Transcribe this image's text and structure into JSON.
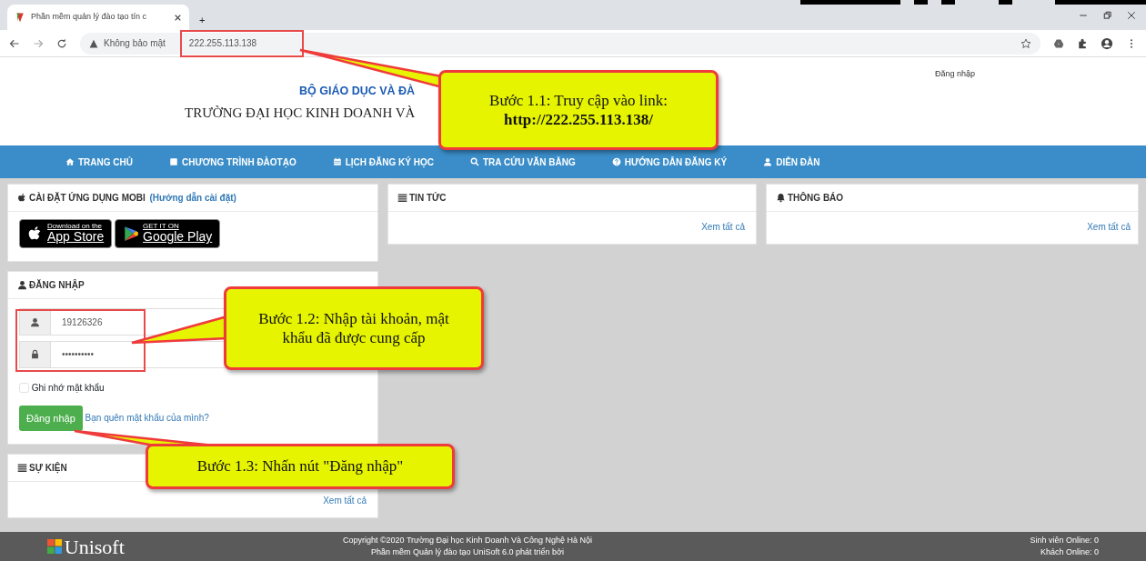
{
  "browser": {
    "tab_title": "Phần mềm quản lý đào tạo tín c",
    "new_tab": "+",
    "security_label": "Không bảo mật",
    "url": "222.255.113.138"
  },
  "header": {
    "ministry": "BỘ GIÁO DỤC VÀ ĐÀ",
    "university": "TRƯỜNG ĐẠI HỌC KINH DOANH VÀ",
    "login_link": "Đăng nhập"
  },
  "nav": [
    {
      "kind": "home",
      "label": "TRANG CHỦ"
    },
    {
      "kind": "book",
      "label": "CHƯƠNG TRÌNH ĐÀOTẠO"
    },
    {
      "kind": "calendar",
      "label": "LỊCH ĐĂNG KÝ HỌC"
    },
    {
      "kind": "search",
      "label": "TRA CỨU VĂN BẰNG"
    },
    {
      "kind": "question",
      "label": "HƯỚNG DẪN ĐĂNG KÝ"
    },
    {
      "kind": "user",
      "label": "DIỄN ĐÀN"
    }
  ],
  "mobile_panel": {
    "title": "CÀI ĐẶT ỨNG DỤNG MOBI",
    "guide_link": "(Hướng dẫn cài đặt)",
    "stores": [
      {
        "kind": "apple",
        "small": "Download on the",
        "big": "App Store"
      },
      {
        "kind": "google",
        "small": "GET IT ON",
        "big": "Google Play"
      }
    ]
  },
  "login_panel": {
    "title": "ĐĂNG NHẬP",
    "username": "19126326",
    "password": "••••••••••",
    "remember_label": "Ghi nhớ mật khẩu",
    "remember_checked": false,
    "submit": "Đăng nhập",
    "forgot_link": "Bạn quên mật khẩu của mình?"
  },
  "events_panel": {
    "title": "SỰ KIỆN",
    "see_all": "Xem tất cả"
  },
  "news_panel": {
    "title": "TIN TỨC",
    "see_all": "Xem tất cả"
  },
  "notice_panel": {
    "title": "THÔNG BÁO",
    "see_all": "Xem tất cả"
  },
  "footer": {
    "logo": "Unisoft",
    "copyright": "Copyright ©2020 Trường Đại học Kinh Doanh Và Công Nghệ Hà Nội",
    "developer": "Phần mềm Quản lý đào tạo UniSoft 6.0 phát triển bởi",
    "students_online": "Sinh viên Online: 0",
    "guests_online": "Khách Online: 0"
  },
  "callouts": [
    {
      "text": "Bước 1.1: Truy cập vào link: **http://222.255.113.138/**"
    },
    {
      "text": "Bước 1.2: Nhập tài khoản, mật khẩu đã được cung cấp"
    },
    {
      "text": "Bước 1.3: Nhấn nút \"Đăng nhập\""
    }
  ]
}
